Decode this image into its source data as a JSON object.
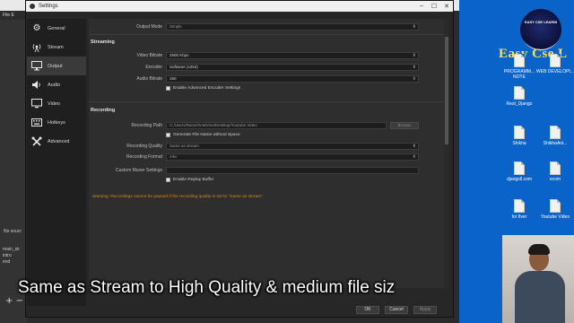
{
  "settings": {
    "title": "Settings",
    "window_buttons": [
      "–",
      "☐",
      "✕"
    ],
    "sidebar": [
      {
        "label": "General",
        "icon": "gear-icon"
      },
      {
        "label": "Stream",
        "icon": "broadcast-icon"
      },
      {
        "label": "Output",
        "icon": "monitor-icon",
        "active": true
      },
      {
        "label": "Audio",
        "icon": "speaker-icon"
      },
      {
        "label": "Video",
        "icon": "display-icon"
      },
      {
        "label": "Hotkeys",
        "icon": "keyboard-icon"
      },
      {
        "label": "Advanced",
        "icon": "tools-icon"
      }
    ],
    "output_mode": {
      "label": "Output Mode",
      "value": "Simple"
    },
    "streaming": {
      "heading": "Streaming",
      "video_bitrate": {
        "label": "Video Bitrate",
        "value": "2500 Kbps"
      },
      "encoder": {
        "label": "Encoder",
        "value": "Software (x264)"
      },
      "audio_bitrate": {
        "label": "Audio Bitrate",
        "value": "160"
      },
      "advanced_encoder": "Enable Advanced Encoder Settings"
    },
    "recording": {
      "heading": "Recording",
      "path": {
        "label": "Recording Path",
        "value": "C:/Users/Rana/OneDrive/Desktop/Youtube Video"
      },
      "browse": "Browse",
      "no_space": "Generate File Name without Space",
      "quality": {
        "label": "Recording Quality",
        "value": "Same as stream"
      },
      "format": {
        "label": "Recording Format",
        "value": "mkv"
      },
      "muxer": {
        "label": "Custom Muxer Settings",
        "value": ""
      },
      "replay_buffer": "Enable Replay Buffer"
    },
    "warning": "Warning: Recordings cannot be paused if the recording quality is set to \"Same as stream\".",
    "buttons": {
      "ok": "OK",
      "cancel": "Cancel",
      "apply": "Apply"
    }
  },
  "obs_main": {
    "menu": "File  E",
    "no_source": "No sourc",
    "scenes": [
      "main_sk",
      "intro",
      "end"
    ],
    "add_button": "+  −"
  },
  "desktop": {
    "logo_text": "EASY CSE LEARNI",
    "brand_text": "Easy Cse L",
    "icons": [
      {
        "label": "PROGRAMM... NOTE"
      },
      {
        "label": "WEB DEVELOPI..."
      },
      {
        "label": "Rest_Django"
      },
      {
        "label": "Shikha"
      },
      {
        "label": "ShikhaAni..."
      },
      {
        "label": "djangoll.com"
      },
      {
        "label": "ecom"
      },
      {
        "label": "for fiver"
      },
      {
        "label": "Youtube Video"
      }
    ]
  },
  "caption": "Same as Stream to High Quality & medium file siz"
}
